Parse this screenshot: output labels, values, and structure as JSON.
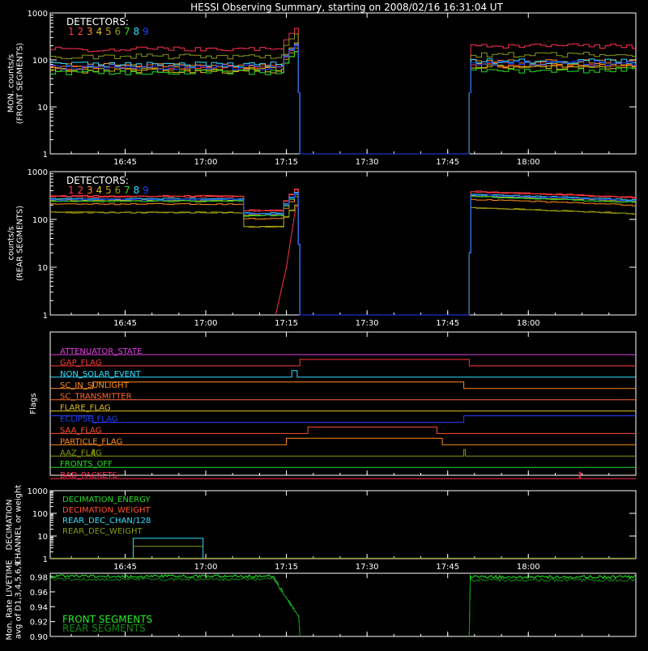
{
  "title": "HESSI Observing Summary, starting on 2008/02/16 16:31:04 UT",
  "x_ticks": [
    "16:45",
    "17:00",
    "17:15",
    "17:30",
    "17:45",
    "18:00"
  ],
  "colors": {
    "det1": "#ff3050",
    "det2": "#ff3a3a",
    "det3": "#ff8c1a",
    "det4": "#e0c020",
    "det5": "#c8a000",
    "det6": "#8a9a10",
    "det7": "#22dd22",
    "det8": "#30e0ff",
    "det9": "#2040ff"
  },
  "chart_data": [
    {
      "id": "front",
      "type": "line",
      "ylabel": [
        "MON. counts/s",
        "(FRONT SEGMENTS)"
      ],
      "ylim": [
        1,
        1000
      ],
      "yscale": "log",
      "y_ticks": [
        "1",
        "10",
        "100",
        "1000"
      ],
      "legend_title": "DETECTORS:",
      "legend_labels": [
        "1",
        "2",
        "3",
        "4",
        "5",
        "6",
        "7",
        "8",
        "9"
      ],
      "series": [
        {
          "name": "1",
          "color_key": "det1",
          "values_pre": 170,
          "values_post": 200
        },
        {
          "name": "2",
          "color_key": "det2",
          "values_pre": 70,
          "values_post": 80
        },
        {
          "name": "3",
          "color_key": "det3",
          "values_pre": 75,
          "values_post": 90
        },
        {
          "name": "4",
          "color_key": "det4",
          "values_pre": 60,
          "values_post": 70
        },
        {
          "name": "5",
          "color_key": "det5",
          "values_pre": 65,
          "values_post": 75
        },
        {
          "name": "6",
          "color_key": "det6",
          "values_pre": 120,
          "values_post": 130
        },
        {
          "name": "7",
          "color_key": "det7",
          "values_pre": 55,
          "values_post": 60
        },
        {
          "name": "8",
          "color_key": "det8",
          "values_pre": 80,
          "values_post": 95
        },
        {
          "name": "9",
          "color_key": "det9",
          "values_pre": 70,
          "values_post": 85
        }
      ]
    },
    {
      "id": "rear",
      "type": "line",
      "ylabel": [
        "counts/s",
        "(REAR SEGMENTS)"
      ],
      "ylim": [
        1,
        1000
      ],
      "yscale": "log",
      "y_ticks": [
        "1",
        "10",
        "100",
        "1000"
      ],
      "legend_title": "DETECTORS:",
      "legend_labels": [
        "1",
        "2",
        "3",
        "4",
        "5",
        "6",
        "7",
        "8",
        "9"
      ],
      "series": [
        {
          "name": "1",
          "color_key": "det1",
          "level": 300
        },
        {
          "name": "2",
          "color_key": "det2",
          "level": 310
        },
        {
          "name": "3",
          "color_key": "det3",
          "level": 210
        },
        {
          "name": "4",
          "color_key": "det4",
          "level": 250
        },
        {
          "name": "5",
          "color_key": "det5",
          "level": 140
        },
        {
          "name": "6",
          "color_key": "det6",
          "level": 140
        },
        {
          "name": "7",
          "color_key": "det7",
          "level": 240
        },
        {
          "name": "8",
          "color_key": "det8",
          "level": 270
        },
        {
          "name": "9",
          "color_key": "det9",
          "level": 260
        }
      ]
    },
    {
      "id": "flags",
      "type": "line",
      "ylabel": [
        "Flags"
      ],
      "flags": [
        {
          "name": "ATTENUATOR_STATE",
          "color": "#e040e0"
        },
        {
          "name": "GAP_FLAG",
          "color": "#ff3a3a"
        },
        {
          "name": "NON_SOLAR_EVENT",
          "color": "#30e0ff"
        },
        {
          "name": "SC_IN_SUNLIGHT",
          "color": "#ff8c1a"
        },
        {
          "name": "SC_TRANSMITTER",
          "color": "#ff6a30"
        },
        {
          "name": "FLARE_FLAG",
          "color": "#e0c020"
        },
        {
          "name": "ECLIPSE_FLAG",
          "color": "#2040ff"
        },
        {
          "name": "SAA_FLAG",
          "color": "#ff5030"
        },
        {
          "name": "PARTICLE_FLAG",
          "color": "#ff8c1a"
        },
        {
          "name": "AAZ_FLAG",
          "color": "#8a9a10"
        },
        {
          "name": "FRONTS_OFF",
          "color": "#22dd22"
        },
        {
          "name": "BAD_PACKETS",
          "color": "#ff3050"
        }
      ]
    },
    {
      "id": "decimation",
      "type": "line",
      "ylabel": [
        "DECIMATION",
        "CHANNEL or weight"
      ],
      "ylim": [
        1,
        1000
      ],
      "yscale": "log",
      "y_ticks": [
        "1",
        "10",
        "100",
        "1000"
      ],
      "series": [
        {
          "name": "DECIMATION_ENERGY",
          "color": "#22dd22"
        },
        {
          "name": "DECIMATION_WEIGHT",
          "color": "#ff5030"
        },
        {
          "name": "REAR_DEC_CHAN/128",
          "color": "#30e0ff"
        },
        {
          "name": "REAR_DEC_WEIGHT",
          "color": "#8a9a10"
        }
      ]
    },
    {
      "id": "livetime",
      "type": "line",
      "ylabel": [
        "Mon. Rate LIVETIME",
        "avg of D1,3,4,5,6,9"
      ],
      "ylim": [
        0.9,
        0.98
      ],
      "y_ticks": [
        "0.90",
        "0.92",
        "0.94",
        "0.96",
        "0.98"
      ],
      "series": [
        {
          "name": "FRONT SEGMENTS",
          "color": "#22ee22",
          "pre": 0.981,
          "post": 0.98
        },
        {
          "name": "REAR SEGMENTS",
          "color": "#118a11",
          "pre": 0.977,
          "post": 0.976
        }
      ]
    }
  ]
}
